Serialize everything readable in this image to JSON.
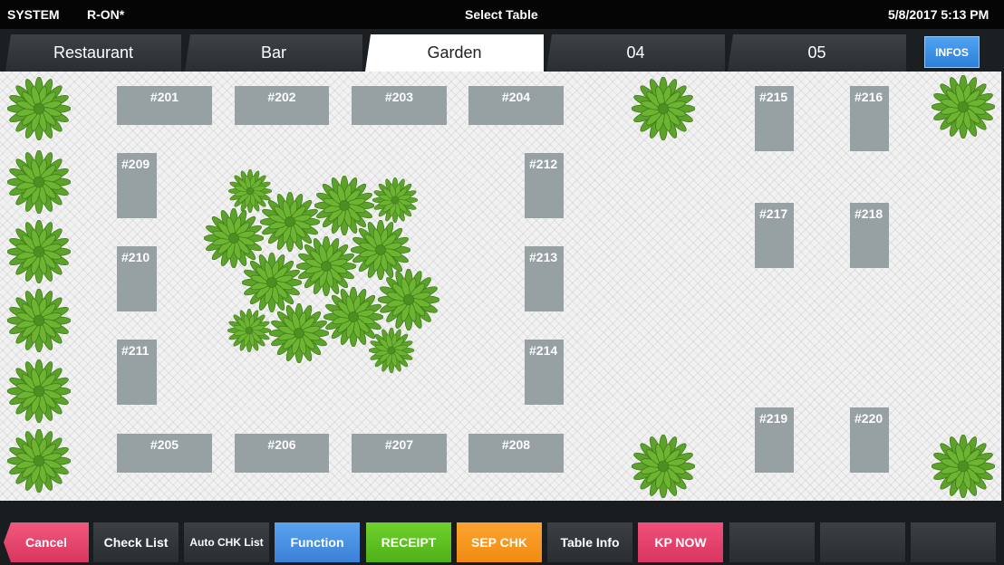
{
  "topbar": {
    "system": "SYSTEM",
    "mode": "R-ON*",
    "title": "Select Table",
    "datetime": "5/8/2017 5:13 PM"
  },
  "tabs": [
    "Restaurant",
    "Bar",
    "Garden",
    "04",
    "05"
  ],
  "active_tab": "Garden",
  "infos_label": "INFOS",
  "tables": {
    "t201": "#201",
    "t202": "#202",
    "t203": "#203",
    "t204": "#204",
    "t205": "#205",
    "t206": "#206",
    "t207": "#207",
    "t208": "#208",
    "t209": "#209",
    "t210": "#210",
    "t211": "#211",
    "t212": "#212",
    "t213": "#213",
    "t214": "#214",
    "t215": "#215",
    "t216": "#216",
    "t217": "#217",
    "t218": "#218",
    "t219": "#219",
    "t220": "#220"
  },
  "functions": {
    "cancel": "Cancel",
    "check_list": "Check List",
    "auto_chk_list": "Auto CHK List",
    "function": "Function",
    "receipt": "RECEIPT",
    "sep_chk": "SEP CHK",
    "table_info": "Table Info",
    "kp_now": "KP NOW"
  },
  "colors": {
    "cancel": "#e8456a",
    "function": "#4a90e2",
    "receipt": "#5cc21c",
    "sep_chk": "#f7941d",
    "kp_now": "#e5406e",
    "table": "#97a1a3",
    "plant": "#5da22a"
  },
  "icons": {
    "plant": "plant-icon"
  }
}
